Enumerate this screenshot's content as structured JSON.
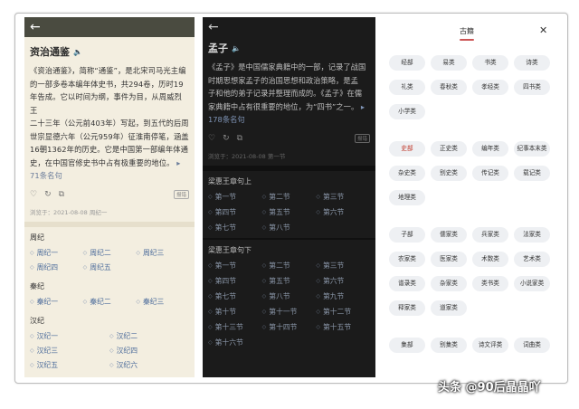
{
  "left": {
    "back_icon": "←",
    "title": "资治通鉴",
    "speaker_icon": "🔈",
    "body_lines": [
      "《资治通鉴》，简称“通鉴”，是北宋司马光主编",
      "的一部多卷本编年体史书，共294卷，历时19",
      "年告成。它以时间为纲，事件为目，从周威烈王",
      "二十三年（公元前403年）写起，到五代的后周",
      "世宗显德六年（公元959年）征淮南停笔，涵盖",
      "16朝1362年的历史。它是中国第一部编年体通",
      "史，在中国官修史书中占有极重要的地位。"
    ],
    "more_link": "71条名句",
    "report": "报错",
    "meta": "浏览于：2021-08-08 周纪一",
    "sections": [
      {
        "title": "周纪",
        "items": [
          "周纪一",
          "周纪二",
          "周纪三",
          "周纪四",
          "周纪五"
        ]
      },
      {
        "title": "秦纪",
        "items": [
          "秦纪一",
          "秦纪二",
          "秦纪三"
        ]
      },
      {
        "title": "汉纪",
        "items": [
          "汉纪一",
          "汉纪二",
          "汉纪三",
          "汉纪四",
          "汉纪五",
          "汉纪六"
        ]
      }
    ]
  },
  "middle": {
    "back_icon": "←",
    "title": "孟子",
    "speaker_icon": "🔈",
    "body_lines": [
      "《孟子》是中国儒家典籍中的一部，记录了战国",
      "时期思想家孟子的治国思想和政治策略，是孟",
      "子和他的弟子记录并整理而成的。《孟子》在儒",
      "家典籍中占有很重要的地位，为“四书”之一。"
    ],
    "more_link": "178条名句",
    "report": "报错",
    "meta": "浏览于：2021-08-08 第一节",
    "sections": [
      {
        "title": "梁惠王章句上",
        "items": [
          "第一节",
          "第二节",
          "第三节",
          "第四节",
          "第五节",
          "第六节",
          "第七节",
          "第八节"
        ]
      },
      {
        "title": "梁惠王章句下",
        "items": [
          "第一节",
          "第二节",
          "第三节",
          "第四节",
          "第五节",
          "第六节",
          "第七节",
          "第八节",
          "第九节",
          "第十节",
          "第十一节",
          "第十二节",
          "第十三节",
          "第十四节",
          "第十五节",
          "第十六节"
        ]
      }
    ]
  },
  "right": {
    "tab": "古籍",
    "close_icon": "✕",
    "groups": [
      [
        "经部",
        "易类",
        "书类",
        "诗类",
        "礼类",
        "春秋类",
        "孝经类",
        "四书类",
        "小学类"
      ],
      [
        "史部",
        "正史类",
        "编年类",
        "纪事本末类",
        "杂史类",
        "别史类",
        "传记类",
        "载记类",
        "地理类"
      ],
      [
        "子部",
        "儒家类",
        "兵家类",
        "法家类",
        "农家类",
        "医家类",
        "术数类",
        "艺术类",
        "谱录类",
        "杂家类",
        "类书类",
        "小说家类",
        "释家类",
        "道家类"
      ],
      [
        "集部",
        "别集类",
        "诗文评类",
        "词曲类"
      ]
    ],
    "active": "史部"
  },
  "watermark": "头条 @90后晶晶吖"
}
